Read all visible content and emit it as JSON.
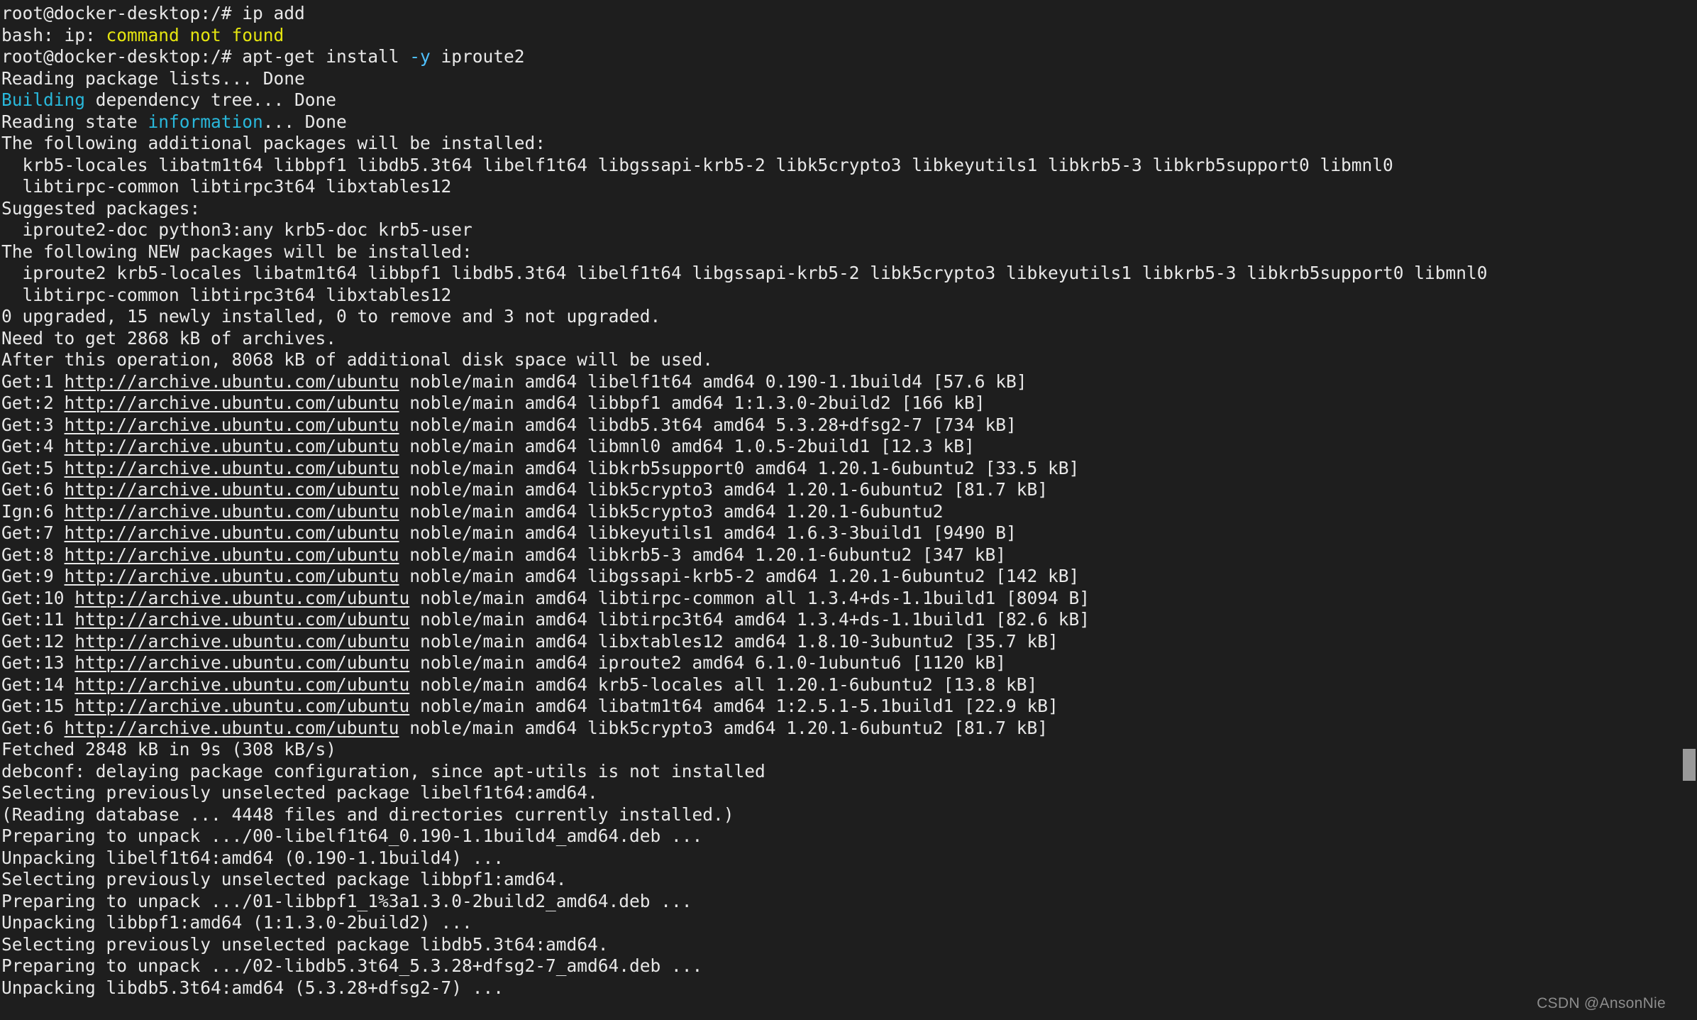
{
  "terminal": {
    "title": "root@docker-desktop: /",
    "prompt": "root@docker-desktop:/#",
    "background_color": "#1e1e1e",
    "foreground_color": "#e8e8e8",
    "error_color": "#e5e510",
    "highlight_color": "#29b8db",
    "flag_color": "#4fc1ff",
    "lines": [
      {
        "id": "l01",
        "segments": [
          {
            "text": "root@docker-desktop:/# ",
            "style": "default"
          },
          {
            "text": "ip add",
            "style": "default"
          }
        ]
      },
      {
        "id": "l02",
        "segments": [
          {
            "text": "bash: ip: ",
            "style": "default"
          },
          {
            "text": "command not found",
            "style": "yellow"
          }
        ]
      },
      {
        "id": "l03",
        "segments": [
          {
            "text": "root@docker-desktop:/# ",
            "style": "default"
          },
          {
            "text": "apt-get install ",
            "style": "default"
          },
          {
            "text": "-y",
            "style": "bright-cyan"
          },
          {
            "text": " iproute2",
            "style": "default"
          }
        ]
      },
      {
        "id": "l04",
        "segments": [
          {
            "text": "Reading package lists... Done",
            "style": "default"
          }
        ]
      },
      {
        "id": "l05",
        "segments": [
          {
            "text": "Building",
            "style": "cyan"
          },
          {
            "text": " dependency tree... Done",
            "style": "default"
          }
        ]
      },
      {
        "id": "l06",
        "segments": [
          {
            "text": "Reading state ",
            "style": "default"
          },
          {
            "text": "information",
            "style": "cyan"
          },
          {
            "text": "... Done",
            "style": "default"
          }
        ]
      },
      {
        "id": "l07",
        "segments": [
          {
            "text": "The following additional packages will be installed:",
            "style": "default"
          }
        ]
      },
      {
        "id": "l08",
        "segments": [
          {
            "text": "  krb5-locales libatm1t64 libbpf1 libdb5.3t64 libelf1t64 libgssapi-krb5-2 libk5crypto3 libkeyutils1 libkrb5-3 libkrb5support0 libmnl0",
            "style": "default"
          }
        ]
      },
      {
        "id": "l09",
        "segments": [
          {
            "text": "  libtirpc-common libtirpc3t64 libxtables12",
            "style": "default"
          }
        ]
      },
      {
        "id": "l10",
        "segments": [
          {
            "text": "Suggested packages:",
            "style": "default"
          }
        ]
      },
      {
        "id": "l11",
        "segments": [
          {
            "text": "  iproute2-doc python3:any krb5-doc krb5-user",
            "style": "default"
          }
        ]
      },
      {
        "id": "l12",
        "segments": [
          {
            "text": "The following NEW packages will be installed:",
            "style": "default"
          }
        ]
      },
      {
        "id": "l13",
        "segments": [
          {
            "text": "  iproute2 krb5-locales libatm1t64 libbpf1 libdb5.3t64 libelf1t64 libgssapi-krb5-2 libk5crypto3 libkeyutils1 libkrb5-3 libkrb5support0 libmnl0",
            "style": "default"
          }
        ]
      },
      {
        "id": "l14",
        "segments": [
          {
            "text": "  libtirpc-common libtirpc3t64 libxtables12",
            "style": "default"
          }
        ]
      },
      {
        "id": "l15",
        "segments": [
          {
            "text": "0 upgraded, 15 newly installed, 0 to remove and 3 not upgraded.",
            "style": "default"
          }
        ]
      },
      {
        "id": "l16",
        "segments": [
          {
            "text": "Need to get 2868 kB of archives.",
            "style": "default"
          }
        ]
      },
      {
        "id": "l17",
        "segments": [
          {
            "text": "After this operation, 8068 kB of additional disk space will be used.",
            "style": "default"
          }
        ]
      },
      {
        "id": "l18",
        "segments": [
          {
            "text": "Get:1 ",
            "style": "default"
          },
          {
            "text": "http://archive.ubuntu.com/ubuntu",
            "style": "link"
          },
          {
            "text": " noble/main amd64 libelf1t64 amd64 0.190-1.1build4 [57.6 kB]",
            "style": "default"
          }
        ]
      },
      {
        "id": "l19",
        "segments": [
          {
            "text": "Get:2 ",
            "style": "default"
          },
          {
            "text": "http://archive.ubuntu.com/ubuntu",
            "style": "link"
          },
          {
            "text": " noble/main amd64 libbpf1 amd64 1:1.3.0-2build2 [166 kB]",
            "style": "default"
          }
        ]
      },
      {
        "id": "l20",
        "segments": [
          {
            "text": "Get:3 ",
            "style": "default"
          },
          {
            "text": "http://archive.ubuntu.com/ubuntu",
            "style": "link"
          },
          {
            "text": " noble/main amd64 libdb5.3t64 amd64 5.3.28+dfsg2-7 [734 kB]",
            "style": "default"
          }
        ]
      },
      {
        "id": "l21",
        "segments": [
          {
            "text": "Get:4 ",
            "style": "default"
          },
          {
            "text": "http://archive.ubuntu.com/ubuntu",
            "style": "link"
          },
          {
            "text": " noble/main amd64 libmnl0 amd64 1.0.5-2build1 [12.3 kB]",
            "style": "default"
          }
        ]
      },
      {
        "id": "l22",
        "segments": [
          {
            "text": "Get:5 ",
            "style": "default"
          },
          {
            "text": "http://archive.ubuntu.com/ubuntu",
            "style": "link"
          },
          {
            "text": " noble/main amd64 libkrb5support0 amd64 1.20.1-6ubuntu2 [33.5 kB]",
            "style": "default"
          }
        ]
      },
      {
        "id": "l23",
        "segments": [
          {
            "text": "Get:6 ",
            "style": "default"
          },
          {
            "text": "http://archive.ubuntu.com/ubuntu",
            "style": "link"
          },
          {
            "text": " noble/main amd64 libk5crypto3 amd64 1.20.1-6ubuntu2 [81.7 kB]",
            "style": "default"
          }
        ]
      },
      {
        "id": "l24",
        "segments": [
          {
            "text": "Ign:6 ",
            "style": "default"
          },
          {
            "text": "http://archive.ubuntu.com/ubuntu",
            "style": "link"
          },
          {
            "text": " noble/main amd64 libk5crypto3 amd64 1.20.1-6ubuntu2",
            "style": "default"
          }
        ]
      },
      {
        "id": "l25",
        "segments": [
          {
            "text": "Get:7 ",
            "style": "default"
          },
          {
            "text": "http://archive.ubuntu.com/ubuntu",
            "style": "link"
          },
          {
            "text": " noble/main amd64 libkeyutils1 amd64 1.6.3-3build1 [9490 B]",
            "style": "default"
          }
        ]
      },
      {
        "id": "l26",
        "segments": [
          {
            "text": "Get:8 ",
            "style": "default"
          },
          {
            "text": "http://archive.ubuntu.com/ubuntu",
            "style": "link"
          },
          {
            "text": " noble/main amd64 libkrb5-3 amd64 1.20.1-6ubuntu2 [347 kB]",
            "style": "default"
          }
        ]
      },
      {
        "id": "l27",
        "segments": [
          {
            "text": "Get:9 ",
            "style": "default"
          },
          {
            "text": "http://archive.ubuntu.com/ubuntu",
            "style": "link"
          },
          {
            "text": " noble/main amd64 libgssapi-krb5-2 amd64 1.20.1-6ubuntu2 [142 kB]",
            "style": "default"
          }
        ]
      },
      {
        "id": "l28",
        "segments": [
          {
            "text": "Get:10 ",
            "style": "default"
          },
          {
            "text": "http://archive.ubuntu.com/ubuntu",
            "style": "link"
          },
          {
            "text": " noble/main amd64 libtirpc-common all 1.3.4+ds-1.1build1 [8094 B]",
            "style": "default"
          }
        ]
      },
      {
        "id": "l29",
        "segments": [
          {
            "text": "Get:11 ",
            "style": "default"
          },
          {
            "text": "http://archive.ubuntu.com/ubuntu",
            "style": "link"
          },
          {
            "text": " noble/main amd64 libtirpc3t64 amd64 1.3.4+ds-1.1build1 [82.6 kB]",
            "style": "default"
          }
        ]
      },
      {
        "id": "l30",
        "segments": [
          {
            "text": "Get:12 ",
            "style": "default"
          },
          {
            "text": "http://archive.ubuntu.com/ubuntu",
            "style": "link"
          },
          {
            "text": " noble/main amd64 libxtables12 amd64 1.8.10-3ubuntu2 [35.7 kB]",
            "style": "default"
          }
        ]
      },
      {
        "id": "l31",
        "segments": [
          {
            "text": "Get:13 ",
            "style": "default"
          },
          {
            "text": "http://archive.ubuntu.com/ubuntu",
            "style": "link"
          },
          {
            "text": " noble/main amd64 iproute2 amd64 6.1.0-1ubuntu6 [1120 kB]",
            "style": "default"
          }
        ]
      },
      {
        "id": "l32",
        "segments": [
          {
            "text": "Get:14 ",
            "style": "default"
          },
          {
            "text": "http://archive.ubuntu.com/ubuntu",
            "style": "link"
          },
          {
            "text": " noble/main amd64 krb5-locales all 1.20.1-6ubuntu2 [13.8 kB]",
            "style": "default"
          }
        ]
      },
      {
        "id": "l33",
        "segments": [
          {
            "text": "Get:15 ",
            "style": "default"
          },
          {
            "text": "http://archive.ubuntu.com/ubuntu",
            "style": "link"
          },
          {
            "text": " noble/main amd64 libatm1t64 amd64 1:2.5.1-5.1build1 [22.9 kB]",
            "style": "default"
          }
        ]
      },
      {
        "id": "l34",
        "segments": [
          {
            "text": "Get:6 ",
            "style": "default"
          },
          {
            "text": "http://archive.ubuntu.com/ubuntu",
            "style": "link"
          },
          {
            "text": " noble/main amd64 libk5crypto3 amd64 1.20.1-6ubuntu2 [81.7 kB]",
            "style": "default"
          }
        ]
      },
      {
        "id": "l35",
        "segments": [
          {
            "text": "Fetched 2848 kB in 9s (308 kB/s)",
            "style": "default"
          }
        ]
      },
      {
        "id": "l36",
        "segments": [
          {
            "text": "debconf: delaying package configuration, since apt-utils is not installed",
            "style": "default"
          }
        ]
      },
      {
        "id": "l37",
        "segments": [
          {
            "text": "Selecting previously unselected package libelf1t64:amd64.",
            "style": "default"
          }
        ]
      },
      {
        "id": "l38",
        "segments": [
          {
            "text": "(Reading database ... 4448 files and directories currently installed.)",
            "style": "default"
          }
        ]
      },
      {
        "id": "l39",
        "segments": [
          {
            "text": "Preparing to unpack .../00-libelf1t64_0.190-1.1build4_amd64.deb ...",
            "style": "default"
          }
        ]
      },
      {
        "id": "l40",
        "segments": [
          {
            "text": "Unpacking libelf1t64:amd64 (0.190-1.1build4) ...",
            "style": "default"
          }
        ]
      },
      {
        "id": "l41",
        "segments": [
          {
            "text": "Selecting previously unselected package libbpf1:amd64.",
            "style": "default"
          }
        ]
      },
      {
        "id": "l42",
        "segments": [
          {
            "text": "Preparing to unpack .../01-libbpf1_1%3a1.3.0-2build2_amd64.deb ...",
            "style": "default"
          }
        ]
      },
      {
        "id": "l43",
        "segments": [
          {
            "text": "Unpacking libbpf1:amd64 (1:1.3.0-2build2) ...",
            "style": "default"
          }
        ]
      },
      {
        "id": "l44",
        "segments": [
          {
            "text": "Selecting previously unselected package libdb5.3t64:amd64.",
            "style": "default"
          }
        ]
      },
      {
        "id": "l45",
        "segments": [
          {
            "text": "Preparing to unpack .../02-libdb5.3t64_5.3.28+dfsg2-7_amd64.deb ...",
            "style": "default"
          }
        ]
      },
      {
        "id": "l46",
        "segments": [
          {
            "text": "Unpacking libdb5.3t64:amd64 (5.3.28+dfsg2-7) ...",
            "style": "default"
          }
        ]
      }
    ]
  },
  "watermark": {
    "text": "CSDN @AnsonNie"
  },
  "scrollbar": {
    "orientation": "vertical"
  }
}
